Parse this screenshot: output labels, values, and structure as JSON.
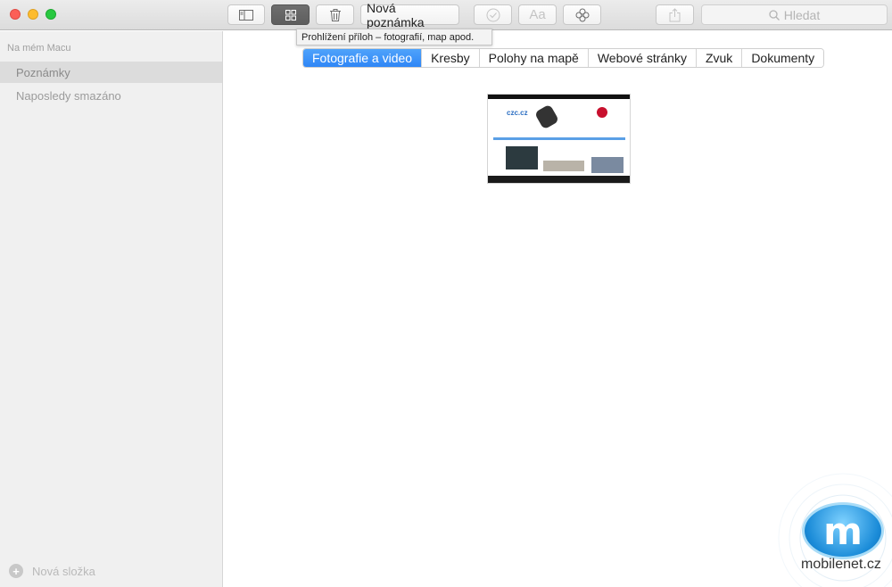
{
  "window": {
    "traffic_lights": [
      "close",
      "minimize",
      "zoom"
    ]
  },
  "toolbar": {
    "buttons": [
      {
        "name": "toggle-sidebar",
        "icon": "sidebar-icon"
      },
      {
        "name": "attachments-browser",
        "icon": "grid-icon",
        "active": true
      },
      {
        "name": "delete",
        "icon": "trash-icon"
      },
      {
        "name": "new-note",
        "label": "Nová poznámka"
      },
      {
        "name": "checklist",
        "icon": "checkmark-circle-icon",
        "disabled": true
      },
      {
        "name": "format",
        "label": "Aa",
        "disabled": true
      },
      {
        "name": "add-people",
        "icon": "flower-icon"
      },
      {
        "name": "share",
        "icon": "share-icon",
        "disabled": true
      }
    ],
    "search_placeholder": "Hledat"
  },
  "tooltip": "Prohlížení příloh – fotografií, map apod.",
  "sidebar": {
    "header": "Na mém Macu",
    "items": [
      {
        "label": "Poznámky",
        "selected": true
      },
      {
        "label": "Naposledy smazáno",
        "selected": false
      }
    ],
    "footer_label": "Nová složka"
  },
  "main": {
    "tabs": [
      {
        "label": "Fotografie a video",
        "active": true
      },
      {
        "label": "Kresby"
      },
      {
        "label": "Polohy na mapě"
      },
      {
        "label": "Webové stránky"
      },
      {
        "label": "Zvuk"
      },
      {
        "label": "Dokumenty"
      }
    ],
    "thumbnail": {
      "logo_text": "czc.cz"
    }
  },
  "watermark": {
    "text": "mobilenet.cz",
    "logo_letter": "m"
  },
  "colors": {
    "accent": "#2f86f6",
    "close": "#fc5f57",
    "minimize": "#fdbc2e",
    "zoom": "#28c840",
    "active_button": "#666666"
  }
}
